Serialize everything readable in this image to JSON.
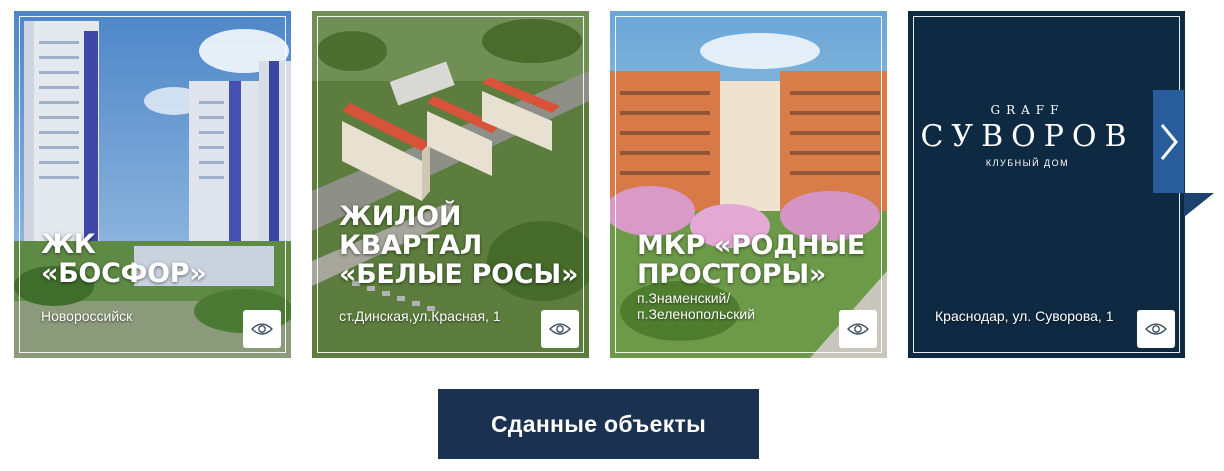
{
  "cards": [
    {
      "title": "ЖК\n«БОСФОР»",
      "address": "Новороссийск",
      "eye_icon": "eye-icon"
    },
    {
      "title": "ЖИЛОЙ\nКВАРТАЛ\n«БЕЛЫЕ РОСЫ»",
      "address": "ст.Динская,ул.Красная, 1",
      "eye_icon": "eye-icon"
    },
    {
      "title": "МКР «РОДНЫЕ\nПРОСТОРЫ»",
      "address": "п.Знаменский/\nп.Зеленопольский",
      "eye_icon": "eye-icon"
    },
    {
      "logo_top": "GRAFF",
      "logo_main": "СУВОРОВ",
      "logo_sub": "КЛУБНЫЙ ДОМ",
      "address": "Краснодар, ул. Суворова, 1",
      "eye_icon": "eye-icon"
    }
  ],
  "carousel": {
    "next_icon": "chevron-right-icon"
  },
  "cta": {
    "label": "Сданные объекты"
  },
  "colors": {
    "navy": "#1b3150",
    "logo_card_bg": "#0e2942",
    "accent_blue": "#285c9a"
  }
}
